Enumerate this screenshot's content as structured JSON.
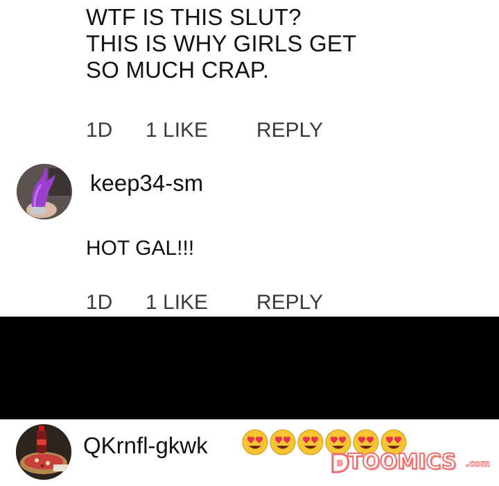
{
  "comment": {
    "lines": [
      "WTF IS THIS SLUT?",
      "THIS IS WHY GIRLS GET",
      "SO MUCH CRAP."
    ],
    "age": "1D",
    "likes": "1 LIKE",
    "reply_label": "REPLY"
  },
  "reply_comment": {
    "username": "keep34-sm",
    "text": "HOT GAL!!!",
    "age": "1D",
    "likes": "1 LIKE",
    "reply_label": "REPLY"
  },
  "next_comment": {
    "username": "QKrnfl-gkwk",
    "emojis": [
      "heart-eyes-icon",
      "heart-eyes-icon",
      "heart-eyes-icon",
      "heart-eyes-icon",
      "heart-eyes-icon",
      "heart-eyes-icon"
    ]
  },
  "watermark": {
    "text": "TOOMICS",
    "suffix": ".com"
  },
  "colors": {
    "background": "#ffffff",
    "text": "#111111",
    "meta_text": "#3a3a3a",
    "censor": "#000000",
    "watermark_outline": "#f06a6a",
    "emoji_face": "#f7c531",
    "emoji_heart": "#e8304a"
  }
}
